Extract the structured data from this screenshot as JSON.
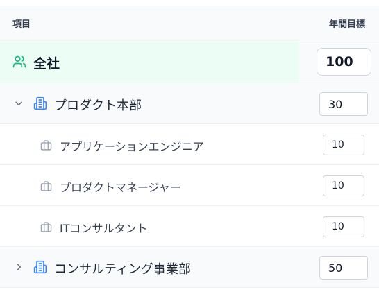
{
  "header": {
    "item_label": "項目",
    "target_label": "年間目標"
  },
  "company": {
    "label": "全社",
    "target": "100",
    "icon": "users-icon"
  },
  "departments": [
    {
      "label": "プロダクト本部",
      "target": "30",
      "expanded": true,
      "icon": "building-icon",
      "roles": [
        {
          "label": "アプリケーションエンジニア",
          "target": "10",
          "icon": "briefcase-icon"
        },
        {
          "label": "プロダクトマネージャー",
          "target": "10",
          "icon": "briefcase-icon"
        },
        {
          "label": "ITコンサルタント",
          "target": "10",
          "icon": "briefcase-icon"
        }
      ]
    },
    {
      "label": "コンサルティング事業部",
      "target": "50",
      "expanded": false,
      "icon": "building-icon",
      "roles": []
    }
  ],
  "colors": {
    "accent_green": "#10b981",
    "accent_blue": "#3b82f6",
    "muted_icon": "#9ca3af"
  }
}
